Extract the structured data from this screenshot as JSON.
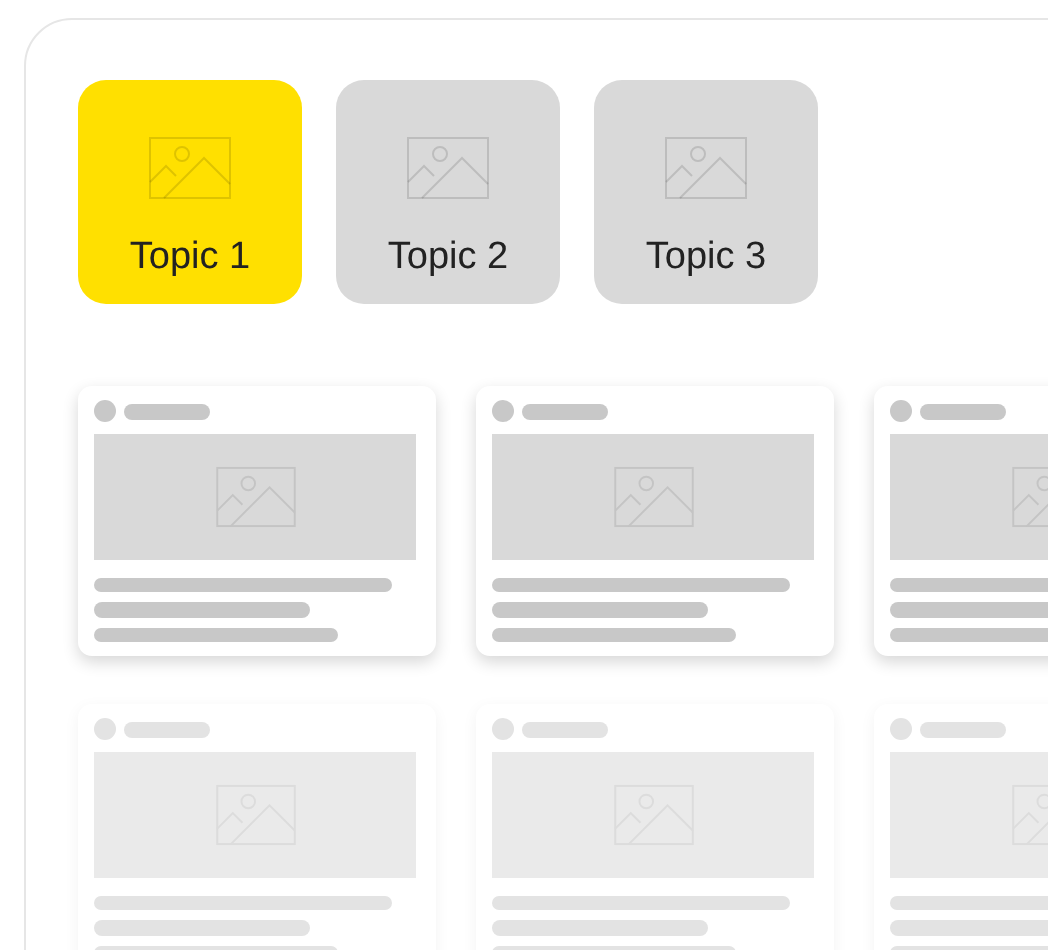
{
  "topics": [
    {
      "label": "Topic 1",
      "selected": true
    },
    {
      "label": "Topic 2",
      "selected": false
    },
    {
      "label": "Topic 3",
      "selected": false
    }
  ],
  "card_rows": [
    {
      "dimmed": false,
      "cards": [
        {
          "kind": "placeholder"
        },
        {
          "kind": "placeholder"
        },
        {
          "kind": "placeholder"
        }
      ]
    },
    {
      "dimmed": true,
      "cards": [
        {
          "kind": "placeholder"
        },
        {
          "kind": "placeholder"
        },
        {
          "kind": "placeholder"
        }
      ]
    }
  ]
}
